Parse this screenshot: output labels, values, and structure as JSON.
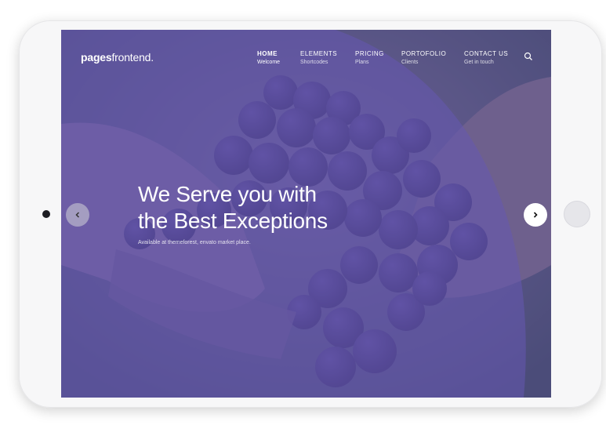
{
  "brand": {
    "logo_bold": "pages",
    "logo_rest": "frontend."
  },
  "nav": {
    "items": [
      {
        "title": "HOME",
        "subtitle": "Welcome"
      },
      {
        "title": "ELEMENTS",
        "subtitle": "Shortcodes"
      },
      {
        "title": "PRICING",
        "subtitle": "Plans"
      },
      {
        "title": "PORTOFOLIO",
        "subtitle": "Clients"
      },
      {
        "title": "CONTACT US",
        "subtitle": "Get in touch"
      }
    ],
    "active_index": 0
  },
  "hero": {
    "title_line1": "We Serve you with",
    "title_line2": "the Best Exceptions",
    "subtitle": "Available at themeforest, envato market place."
  },
  "icons": {
    "search": "search-icon",
    "prev": "chevron-left-icon",
    "next": "chevron-right-icon"
  },
  "colors": {
    "overlay": "#5b4fa0",
    "curve_overlay": "#6657b3",
    "device": "#f7f7f8",
    "text": "#ffffff"
  }
}
